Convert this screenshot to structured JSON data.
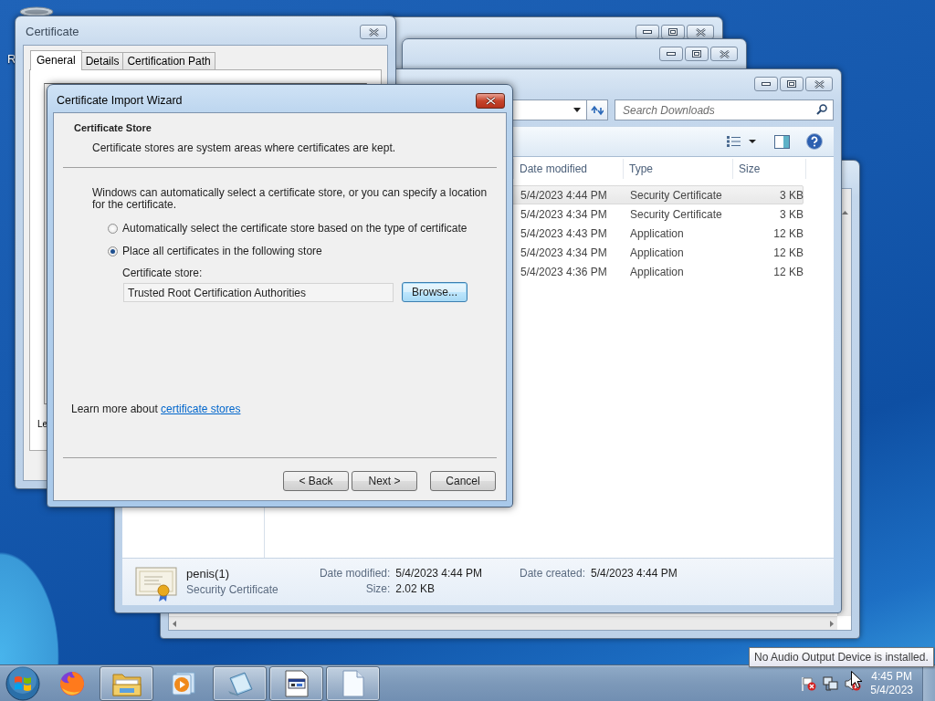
{
  "desktop": {
    "icon_label": "R"
  },
  "explorer": {
    "search": {
      "placeholder": "Search Downloads"
    },
    "columns": [
      "Date modified",
      "Type",
      "Size"
    ],
    "rows": [
      {
        "date": "5/4/2023 4:44 PM",
        "type": "Security Certificate",
        "size": "3 KB",
        "highlighted": true
      },
      {
        "date": "5/4/2023 4:34 PM",
        "type": "Security Certificate",
        "size": "3 KB",
        "highlighted": false
      },
      {
        "date": "5/4/2023 4:43 PM",
        "type": "Application",
        "size": "12 KB",
        "highlighted": false
      },
      {
        "date": "5/4/2023 4:34 PM",
        "type": "Application",
        "size": "12 KB",
        "highlighted": false
      },
      {
        "date": "5/4/2023 4:36 PM",
        "type": "Application",
        "size": "12 KB",
        "highlighted": false
      }
    ],
    "details": {
      "name": "penis(1)",
      "type": "Security Certificate",
      "modified_label": "Date modified:",
      "modified": "5/4/2023 4:44 PM",
      "created_label": "Date created:",
      "created": "5/4/2023 4:44 PM",
      "size_label": "Size:",
      "size": "2.02 KB"
    }
  },
  "certificate_window": {
    "title": "Certificate",
    "tabs": [
      {
        "label": "General",
        "selected": true
      },
      {
        "label": "Details",
        "selected": false
      },
      {
        "label": "Certification Path",
        "selected": false
      }
    ],
    "cut_text": "Le"
  },
  "wizard": {
    "title": "Certificate Import Wizard",
    "heading": "Certificate Store",
    "subheading": "Certificate stores are system areas where certificates are kept.",
    "intro": "Windows can automatically select a certificate store, or you can specify a location for the certificate.",
    "options": [
      {
        "label": "Automatically select the certificate store based on the type of certificate",
        "selected": false
      },
      {
        "label": "Place all certificates in the following store",
        "selected": true
      }
    ],
    "store_label": "Certificate store:",
    "store_value": "Trusted Root Certification Authorities",
    "browse_button": "Browse...",
    "learn_more": {
      "text": "Learn more about",
      "link": "certificate stores"
    },
    "buttons": [
      {
        "label": "< Back",
        "kind": "back"
      },
      {
        "label": "Next >",
        "kind": "next"
      },
      {
        "label": "Cancel",
        "kind": "cancel"
      }
    ]
  },
  "taskbar": {
    "items": [
      {
        "kind": "firefox",
        "running": false
      },
      {
        "kind": "folder",
        "running": true
      },
      {
        "kind": "media",
        "running": false
      },
      {
        "kind": "notepad",
        "running": true
      },
      {
        "kind": "document",
        "running": true
      },
      {
        "kind": "blank-file",
        "running": true
      }
    ],
    "clock": {
      "time": "4:45 PM",
      "date": "5/4/2023"
    }
  },
  "tooltip": "No Audio Output Device is installed."
}
